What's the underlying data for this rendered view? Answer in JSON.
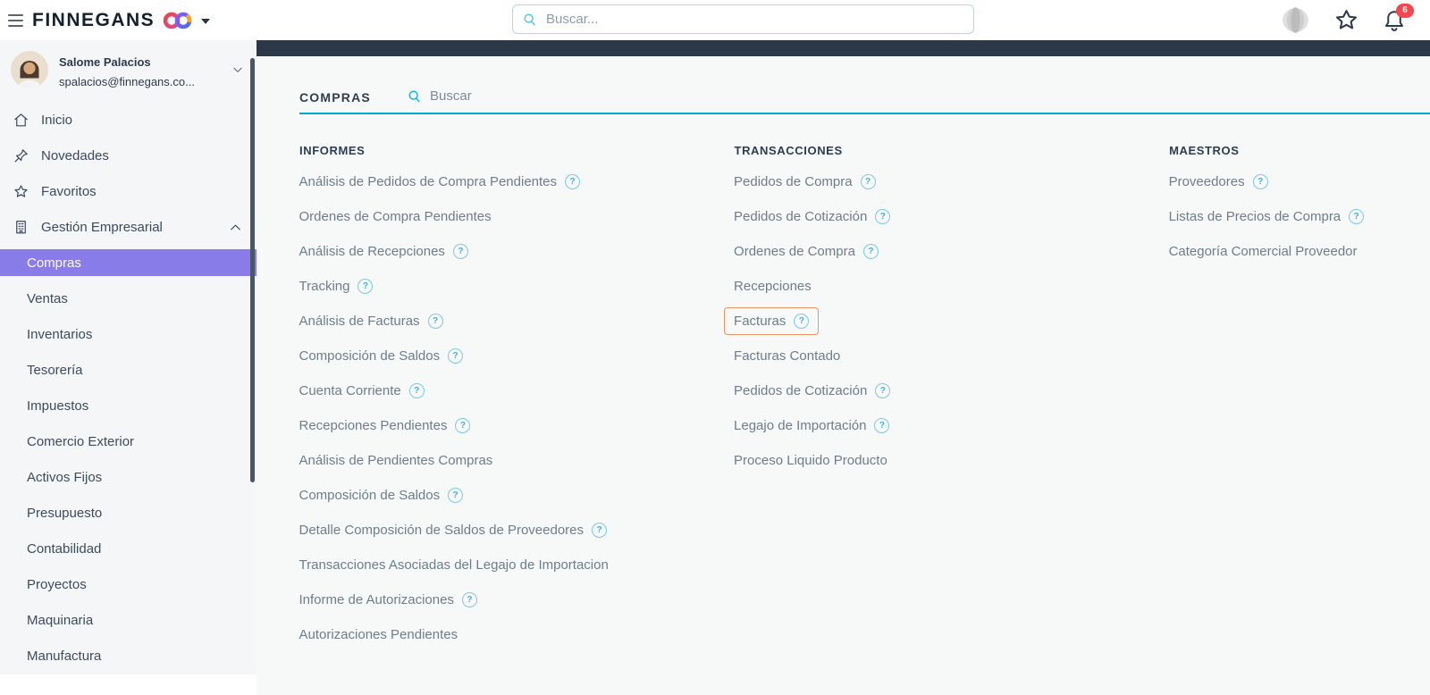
{
  "topbar": {
    "brand": "FINNEGANS",
    "search": {
      "placeholder": "Buscar..."
    },
    "notifications_count": "6"
  },
  "user": {
    "name": "Salome Palacios",
    "email": "spalacios@finnegans.co..."
  },
  "sidebar": {
    "items": [
      {
        "label": "Inicio",
        "icon": "home-icon"
      },
      {
        "label": "Novedades",
        "icon": "pin-icon"
      },
      {
        "label": "Favoritos",
        "icon": "star-icon"
      },
      {
        "label": "Gestión Empresarial",
        "icon": "building-icon",
        "expanded": true
      }
    ],
    "submenu": [
      "Compras",
      "Ventas",
      "Inventarios",
      "Tesorería",
      "Impuestos",
      "Comercio Exterior",
      "Activos Fijos",
      "Presupuesto",
      "Contabilidad",
      "Proyectos",
      "Maquinaria",
      "Manufactura"
    ],
    "selected_submenu": "Compras"
  },
  "main": {
    "module_title": "COMPRAS",
    "module_search_label": "Buscar",
    "columns": [
      {
        "header": "INFORMES",
        "items": [
          {
            "label": "Análisis de Pedidos de Compra Pendientes",
            "help": true
          },
          {
            "label": "Ordenes de Compra Pendientes",
            "help": false
          },
          {
            "label": "Análisis de Recepciones",
            "help": true
          },
          {
            "label": "Tracking",
            "help": true
          },
          {
            "label": "Análisis de Facturas",
            "help": true
          },
          {
            "label": "Composición de Saldos",
            "help": true
          },
          {
            "label": "Cuenta Corriente",
            "help": true
          },
          {
            "label": "Recepciones Pendientes",
            "help": true
          },
          {
            "label": "Análisis de Pendientes Compras",
            "help": false
          },
          {
            "label": "Composición de Saldos",
            "help": true
          },
          {
            "label": "Detalle Composición de Saldos de Proveedores",
            "help": true
          },
          {
            "label": "Transacciones Asociadas del Legajo de Importacion",
            "help": false
          },
          {
            "label": "Informe de Autorizaciones",
            "help": true
          },
          {
            "label": "Autorizaciones Pendientes",
            "help": false
          }
        ]
      },
      {
        "header": "TRANSACCIONES",
        "items": [
          {
            "label": "Pedidos de Compra",
            "help": true
          },
          {
            "label": "Pedidos de Cotización",
            "help": true
          },
          {
            "label": "Ordenes de Compra",
            "help": true
          },
          {
            "label": "Recepciones",
            "help": false
          },
          {
            "label": "Facturas",
            "help": true,
            "highlighted": true
          },
          {
            "label": "Facturas Contado",
            "help": false
          },
          {
            "label": "Pedidos de Cotización",
            "help": true
          },
          {
            "label": "Legajo de Importación",
            "help": true
          },
          {
            "label": "Proceso Liquido Producto",
            "help": false
          }
        ]
      },
      {
        "header": "MAESTROS",
        "items": [
          {
            "label": "Proveedores",
            "help": true
          },
          {
            "label": "Listas de Precios de Compra",
            "help": true
          },
          {
            "label": "Categoría Comercial Proveedor",
            "help": false
          }
        ]
      }
    ]
  },
  "colors": {
    "accent-purple": "#8a7ce8",
    "teal-underline": "#00a9c9",
    "highlight-orange": "#ee9466",
    "help-blue": "#7cc8e8",
    "badge-red": "#f0484d",
    "navy": "#2c3848",
    "item-gray": "#6f7d8a",
    "search-border": "#a8dcf2"
  }
}
